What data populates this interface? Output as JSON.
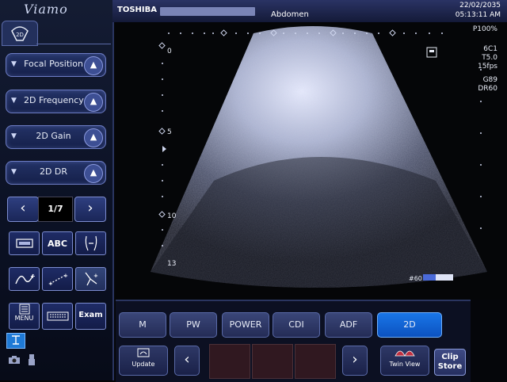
{
  "sidebar": {
    "logo": "Viamo",
    "mode_tab_icon": "2d-probe-icon",
    "mode_tab_label": "2D",
    "controls": [
      {
        "label": "Focal Position"
      },
      {
        "label": "2D Frequency"
      },
      {
        "label": "2D Gain"
      },
      {
        "label": "2D DR"
      }
    ],
    "page_indicator": "1/7",
    "tools_row1": [
      "image-store-icon",
      "ABC",
      "body-mark-icon"
    ],
    "tools_row2": [
      "trace-icon",
      "distance-icon",
      "caliper-icon"
    ],
    "menu_label": "MENU",
    "exam_label": "Exam"
  },
  "header": {
    "brand": "TOSHIBA",
    "exam_type": "Abdomen",
    "date": "22/02/2035",
    "time": "05:13:11 AM"
  },
  "imaging": {
    "power": "P100%",
    "params": [
      "6C1",
      "T5.0",
      "15fps",
      "G89",
      "DR60"
    ],
    "depth_marks": [
      "0",
      "5",
      "10",
      "13"
    ],
    "grayscale_label": "#60"
  },
  "bottom_bar": {
    "modes": [
      "M",
      "PW",
      "POWER",
      "CDI",
      "ADF",
      "2D"
    ],
    "active_mode": "2D",
    "update_label": "Update",
    "twinview_label": "Twin View",
    "clip_store_label_1": "Clip",
    "clip_store_label_2": "Store"
  },
  "colors": {
    "accent_active": "#1976e8",
    "panel_border": "#6c7cc4"
  }
}
